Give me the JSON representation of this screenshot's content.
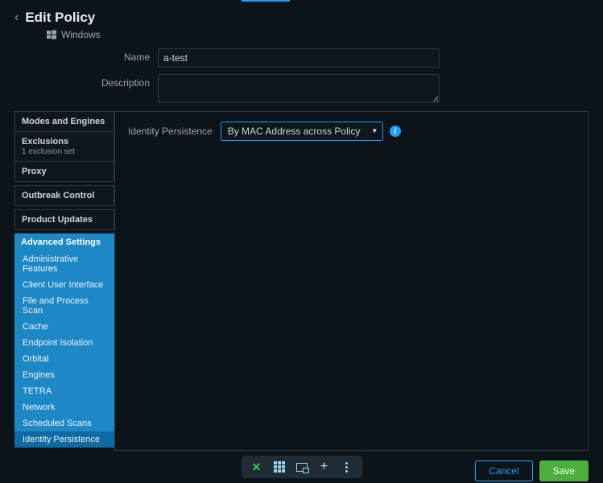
{
  "header": {
    "title": "Edit Policy",
    "os_label": "Windows"
  },
  "form": {
    "name_label": "Name",
    "name_value": "a-test",
    "description_label": "Description",
    "description_value": ""
  },
  "sidebar": {
    "group1": {
      "modes": "Modes and Engines",
      "exclusions": "Exclusions",
      "exclusions_sub": "1 exclusion set",
      "proxy": "Proxy"
    },
    "outbreak": "Outbreak Control",
    "updates": "Product Updates",
    "advanced": {
      "head": "Advanced Settings",
      "items": [
        "Administrative Features",
        "Client User Interface",
        "File and Process Scan",
        "Cache",
        "Endpoint Isolation",
        "Orbital",
        "Engines",
        "TETRA",
        "Network",
        "Scheduled Scans",
        "Identity Persistence"
      ],
      "active_index": 10
    }
  },
  "content": {
    "identity_persistence_label": "Identity Persistence",
    "identity_persistence_value": "By MAC Address across Policy"
  },
  "footer": {
    "cancel": "Cancel",
    "save": "Save"
  }
}
